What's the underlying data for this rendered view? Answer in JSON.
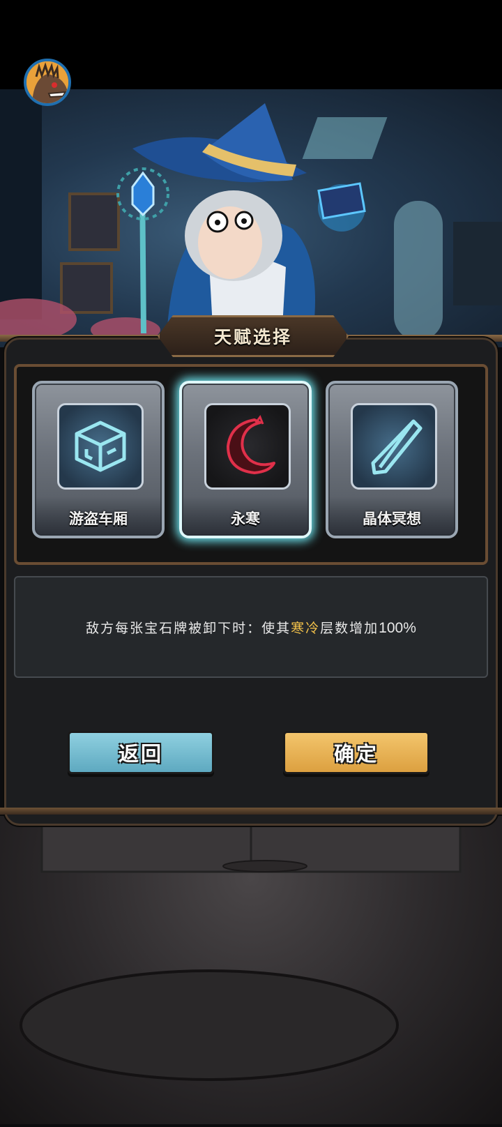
{
  "header": {
    "title": "天赋选择"
  },
  "talents": [
    {
      "name": "游盗车厢",
      "icon": "cube-icon",
      "selected": false
    },
    {
      "name": "永寒",
      "icon": "crescent-moon-icon",
      "selected": true
    },
    {
      "name": "晶体冥想",
      "icon": "crystal-icon",
      "selected": false
    }
  ],
  "description": {
    "before": "敌方每张宝石牌被卸下时：使其",
    "highlight": "寒冷",
    "after": "层数增加",
    "value": "100%"
  },
  "buttons": {
    "back": "返回",
    "confirm": "确定"
  },
  "colors": {
    "highlight": "#f2c14a",
    "selected_glow": "#6fe6f0",
    "back_button": "#7dc2d6",
    "confirm_button": "#e8b353"
  }
}
